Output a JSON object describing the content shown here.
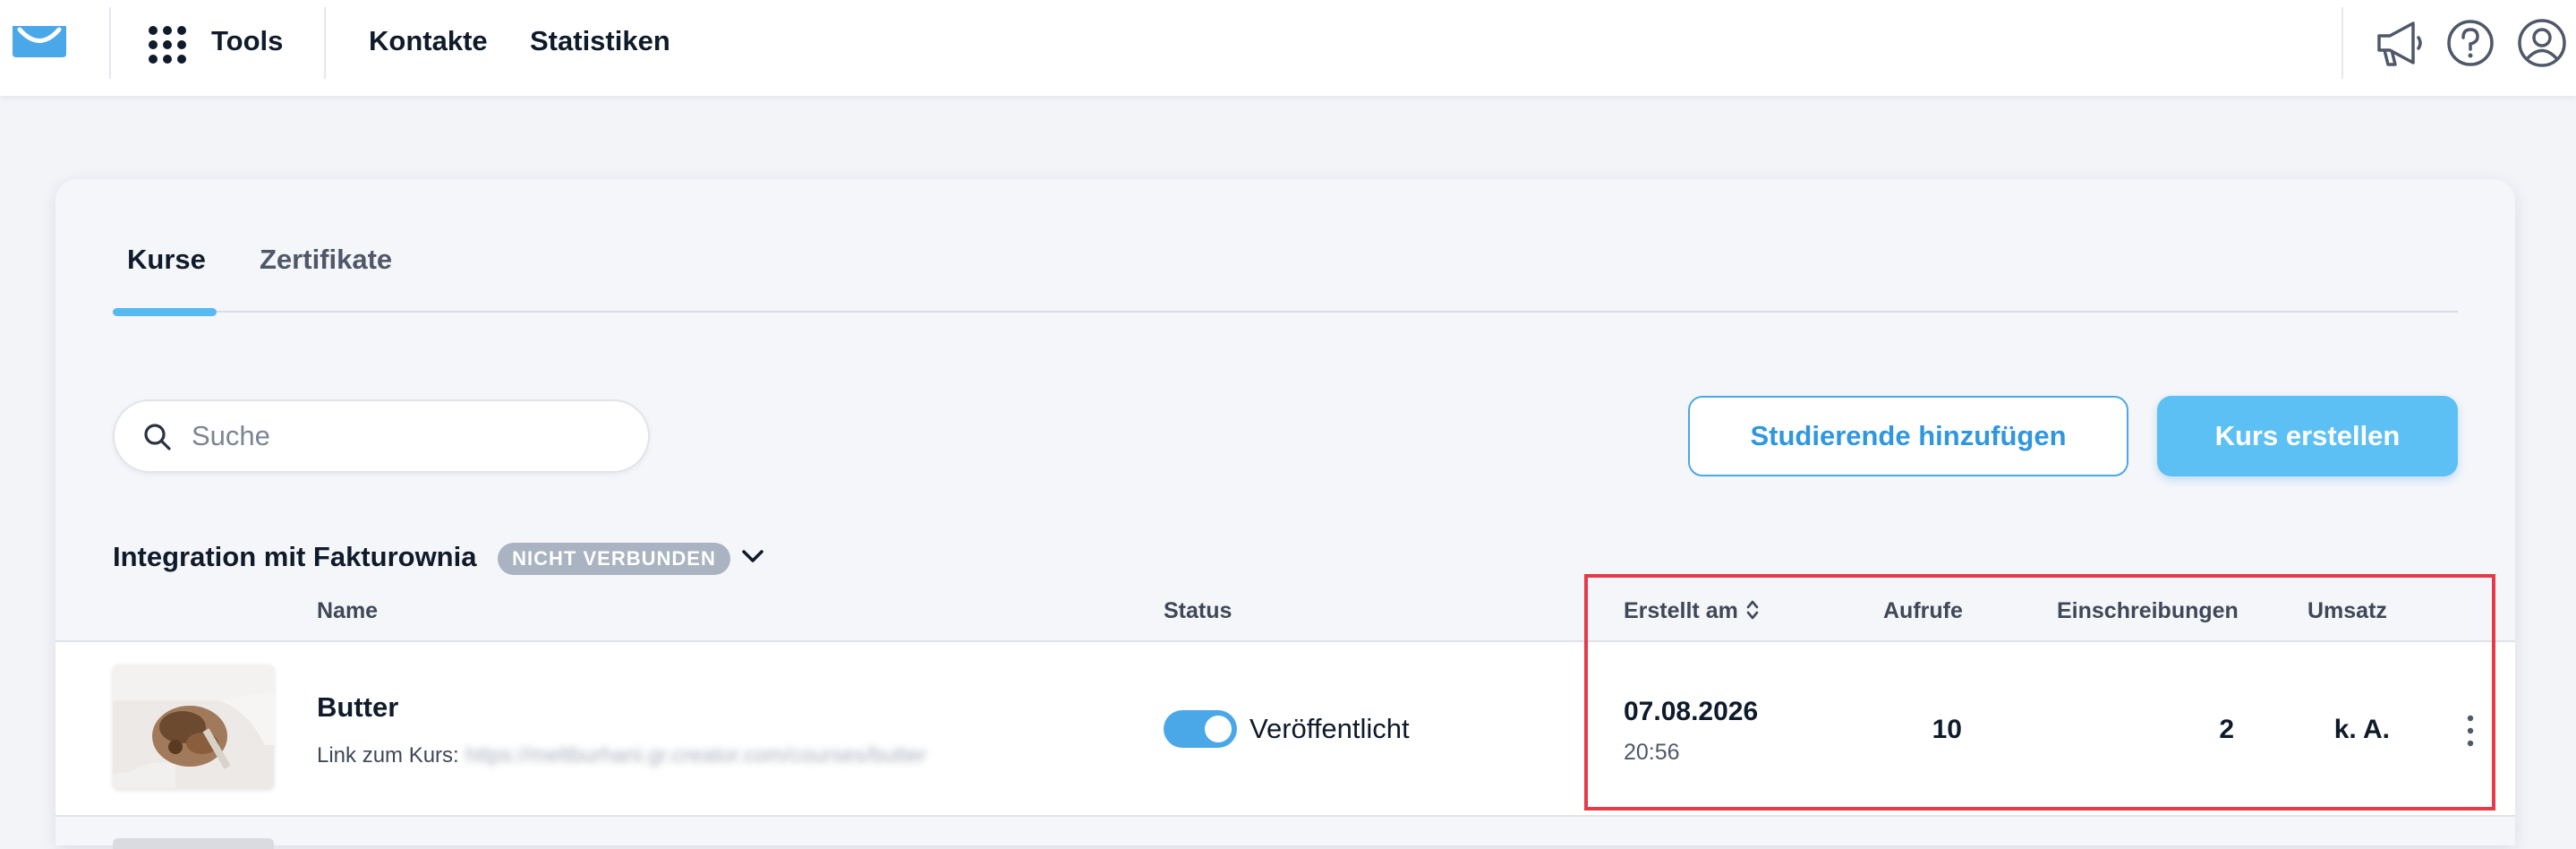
{
  "header": {
    "tools_label": "Tools",
    "nav": [
      "Kontakte",
      "Statistiken"
    ]
  },
  "tabs": [
    {
      "label": "Kurse",
      "active": true
    },
    {
      "label": "Zertifikate",
      "active": false
    }
  ],
  "search": {
    "placeholder": "Suche",
    "value": ""
  },
  "buttons": {
    "add_students": "Studierende hinzufügen",
    "create_course": "Kurs erstellen"
  },
  "integration": {
    "label": "Integration mit Fakturownia",
    "badge": "NICHT VERBUNDEN"
  },
  "table": {
    "columns": {
      "name": "Name",
      "status": "Status",
      "created": "Erstellt am",
      "views": "Aufrufe",
      "enrollments": "Einschreibungen",
      "revenue": "Umsatz"
    },
    "rows": [
      {
        "name": "Butter",
        "link_label": "Link zum Kurs:",
        "link_url": "https://meltburhani.gr.creator.com/courses/butter",
        "status": "Veröffentlicht",
        "published": true,
        "created_date": "07.08.2026",
        "created_time": "20:56",
        "views": "10",
        "enrollments": "2",
        "revenue": "k. A."
      }
    ]
  },
  "colors": {
    "accent": "#56b9f2",
    "primary_button": "#5cc0f4",
    "highlight": "#e63a48",
    "badge": "#a9b3c1"
  },
  "icons": [
    "envelope-logo-icon",
    "app-grid-icon",
    "megaphone-icon",
    "help-icon",
    "user-account-icon",
    "search-icon",
    "chevron-down-icon",
    "sort-icon",
    "kebab-menu-icon"
  ]
}
